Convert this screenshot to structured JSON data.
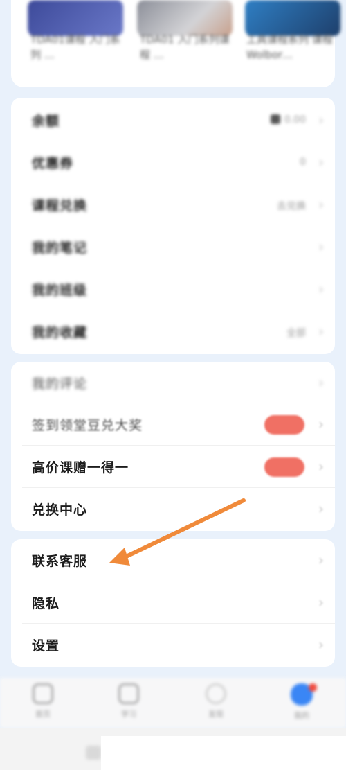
{
  "courses": {
    "items": [
      {
        "caption": "TDA01课程 入门系列 …"
      },
      {
        "caption": "TDA01 入门系列课程 …"
      },
      {
        "caption": "工具课程系列 课程Wolbor…"
      }
    ]
  },
  "profile_menu": {
    "items": [
      {
        "label": "余额",
        "value": "0.00"
      },
      {
        "label": "优惠券",
        "value": "0"
      },
      {
        "label": "课程兑换",
        "value": "去兑换"
      },
      {
        "label": "我的笔记",
        "value": ""
      },
      {
        "label": "我的班级",
        "value": ""
      },
      {
        "label": "我的收藏",
        "value": "全部"
      }
    ]
  },
  "activity_menu": {
    "items": [
      {
        "label": "我的评论",
        "value": ""
      },
      {
        "label": "签到领堂豆兑大奖",
        "value": ""
      },
      {
        "label": "高价课赠一得一",
        "value": ""
      },
      {
        "label": "兑换中心",
        "value": ""
      }
    ]
  },
  "service_menu": {
    "items": [
      {
        "label": "联系客服"
      },
      {
        "label": "隐私"
      },
      {
        "label": "设置"
      }
    ]
  },
  "tabbar": {
    "tabs": [
      {
        "label": "首页",
        "icon": "play-icon"
      },
      {
        "label": "学习",
        "icon": "book-icon"
      },
      {
        "label": "发现",
        "icon": "circle-icon"
      },
      {
        "label": "我的",
        "icon": "profile-icon"
      }
    ]
  },
  "colors": {
    "accent": "#3a86f5",
    "pill": "#f07064",
    "arrow": "#f08a3a"
  }
}
